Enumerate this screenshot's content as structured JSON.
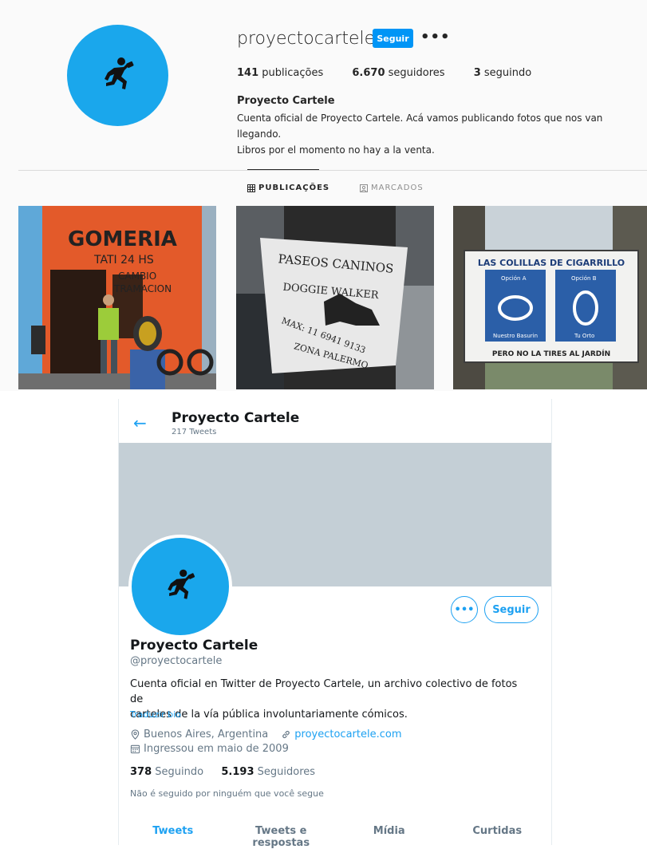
{
  "instagram": {
    "username": "proyectocartele",
    "follow_label": "Seguir",
    "more_label": "•••",
    "stats": {
      "posts_count": "141",
      "posts_label": "publicações",
      "followers_count": "6.670",
      "followers_label": "seguidores",
      "following_count": "3",
      "following_label": "seguindo"
    },
    "full_name": "Proyecto Cartele",
    "bio_line1": "Cuenta oficial de Proyecto Cartele. Acá vamos publicando fotos que nos van llegando.",
    "bio_line2": "Libros por el momento no hay a la venta.",
    "tabs": {
      "posts": "PUBLICAÇÕES",
      "tagged": "MARCADOS"
    },
    "posts": [
      {
        "sign_text_1": "GOMERIA",
        "sign_text_2": "TATI 24 HS",
        "sign_text_3": "CAMBIO",
        "sign_text_4": "TRAMACION"
      },
      {
        "sign_text_1": "PASEOS CANINOS",
        "sign_text_2": "DOGGIE WALKER",
        "sign_text_3": "MAX: 11 6941 9133",
        "sign_text_4": "ZONA PALERMO"
      },
      {
        "sign_text_1": "LAS COLILLAS DE CIGARRILLO",
        "option_a": "Opción A",
        "option_b": "Opción B",
        "label_a": "Nuestro Basurin",
        "label_b": "Tu Orto",
        "footer": "PERO NO LA TIRES AL JARDÍN"
      }
    ]
  },
  "twitter": {
    "header_name": "Proyecto Cartele",
    "tweet_count": "217 Tweets",
    "follow_label": "Seguir",
    "more_label": "•••",
    "name": "Proyecto Cartele",
    "handle": "@proyectocartele",
    "bio_line1": "Cuenta oficial en Twitter de Proyecto Cartele, un archivo colectivo de fotos de",
    "bio_line2": "carteles de la vía pública involuntariamente cómicos.",
    "translate_label": "Traduzir bio",
    "location": "Buenos Aires, Argentina",
    "website": "proyectocartele.com",
    "joined": "Ingressou em maio de 2009",
    "following_count": "378",
    "following_label": "Seguindo",
    "followers_count": "5.193",
    "followers_label": "Seguidores",
    "not_followed": "Não é seguido por ninguém que você segue",
    "tabs": [
      "Tweets",
      "Tweets e respostas",
      "Mídia",
      "Curtidas"
    ]
  }
}
